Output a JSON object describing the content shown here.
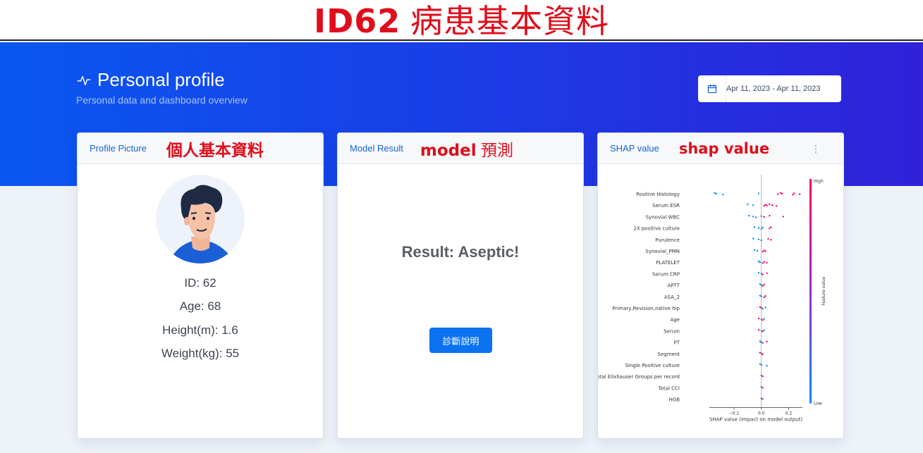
{
  "banner": {
    "id_text": "ID62",
    "zh_text": "病患基本資料"
  },
  "header": {
    "title": "Personal profile",
    "subtitle": "Personal data and dashboard overview",
    "date_range": "Apr 11, 2023 - Apr 11, 2023"
  },
  "profile_card": {
    "title": "Profile Picture",
    "annotation": "個人基本資料",
    "id": "ID: 62",
    "age": "Age: 68",
    "height": "Height(m): 1.6",
    "weight": "Weight(kg): 55"
  },
  "model_card": {
    "title": "Model Result",
    "annotation_en": "model",
    "annotation_zh": "預測",
    "result": "Result: Aseptic!",
    "button": "診斷說明"
  },
  "shap_card": {
    "title": "SHAP value",
    "annotation": "shap value",
    "menu_icon": "vertical-dots-icon"
  },
  "chart_data": {
    "type": "scatter",
    "features": [
      "Positive Histology",
      "Serum ESR",
      "Synovial WBC",
      "2X positive culture",
      "Purulence",
      "Synovial_PMN",
      "PLATELET",
      "Serum CRP",
      "APTT",
      "ASA_2",
      "Primary,Revision,native hip",
      "Age",
      "Serum",
      "PT",
      "Segment",
      "Single Positive culture",
      "Total Elixhauser Groups per record",
      "Total CCI",
      "HGB"
    ],
    "xlabel": "SHAP value (impact on model output)",
    "x_ticks": [
      "−0.2",
      "0.0",
      "0.2"
    ],
    "xlim": [
      -0.38,
      0.3
    ],
    "colorbar": {
      "high": "High",
      "low": "Low",
      "label": "Feature value"
    },
    "colors": {
      "high": "#ff0052",
      "low": "#008bfb"
    },
    "points": [
      {
        "feature": 0,
        "x": [
          -0.34,
          -0.33,
          -0.28,
          -0.02,
          0.12,
          0.14,
          0.15,
          0.23,
          0.24,
          0.28
        ],
        "c": [
          0,
          0,
          0,
          0,
          1,
          1,
          1,
          1,
          1,
          1
        ]
      },
      {
        "feature": 1,
        "x": [
          -0.1,
          -0.06,
          0.02,
          0.03,
          0.04,
          0.06,
          0.08,
          0.11
        ],
        "c": [
          0,
          0,
          1,
          1,
          1,
          1,
          1,
          1
        ]
      },
      {
        "feature": 2,
        "x": [
          -0.09,
          -0.06,
          -0.04,
          0.0,
          0.02,
          0.06,
          0.16
        ],
        "c": [
          0,
          0,
          0,
          0,
          1,
          1,
          1
        ]
      },
      {
        "feature": 3,
        "x": [
          -0.05,
          -0.02,
          0.0,
          0.01,
          0.06,
          0.07
        ],
        "c": [
          0,
          0,
          0,
          0,
          1,
          1
        ]
      },
      {
        "feature": 4,
        "x": [
          -0.06,
          -0.02,
          0.0,
          0.05,
          0.07
        ],
        "c": [
          0,
          0,
          0,
          1,
          1
        ]
      },
      {
        "feature": 5,
        "x": [
          -0.05,
          -0.03,
          0.01,
          0.02,
          0.03
        ],
        "c": [
          0,
          0,
          1,
          1,
          1
        ]
      },
      {
        "feature": 6,
        "x": [
          -0.02,
          -0.01,
          0.01,
          0.02,
          0.04
        ],
        "c": [
          0,
          0,
          1,
          1,
          1
        ]
      },
      {
        "feature": 7,
        "x": [
          -0.02,
          0.0,
          0.01,
          0.04
        ],
        "c": [
          0,
          0,
          1,
          1
        ]
      },
      {
        "feature": 8,
        "x": [
          -0.01,
          0.0,
          0.01,
          0.02
        ],
        "c": [
          0,
          0,
          1,
          1
        ]
      },
      {
        "feature": 9,
        "x": [
          -0.01,
          0.0,
          0.02,
          0.03
        ],
        "c": [
          0,
          0,
          1,
          1
        ]
      },
      {
        "feature": 10,
        "x": [
          -0.01,
          0.0,
          0.01,
          0.03
        ],
        "c": [
          1,
          1,
          0,
          0
        ]
      },
      {
        "feature": 11,
        "x": [
          -0.02,
          0.0,
          0.01,
          0.02
        ],
        "c": [
          1,
          0,
          1,
          0
        ]
      },
      {
        "feature": 12,
        "x": [
          -0.02,
          0.0,
          0.01,
          0.02
        ],
        "c": [
          1,
          0,
          1,
          0
        ]
      },
      {
        "feature": 13,
        "x": [
          -0.01,
          0.0,
          0.01,
          0.04
        ],
        "c": [
          0,
          1,
          0,
          1
        ]
      },
      {
        "feature": 14,
        "x": [
          -0.01,
          0.0,
          0.01
        ],
        "c": [
          1,
          0,
          1
        ]
      },
      {
        "feature": 15,
        "x": [
          -0.01,
          0.0,
          0.04
        ],
        "c": [
          0,
          0,
          0
        ]
      },
      {
        "feature": 16,
        "x": [
          0.0,
          0.01
        ],
        "c": [
          0,
          1
        ]
      },
      {
        "feature": 17,
        "x": [
          0.0,
          0.01
        ],
        "c": [
          0,
          1
        ]
      },
      {
        "feature": 18,
        "x": [
          0.0,
          0.01
        ],
        "c": [
          1,
          0
        ]
      }
    ]
  }
}
